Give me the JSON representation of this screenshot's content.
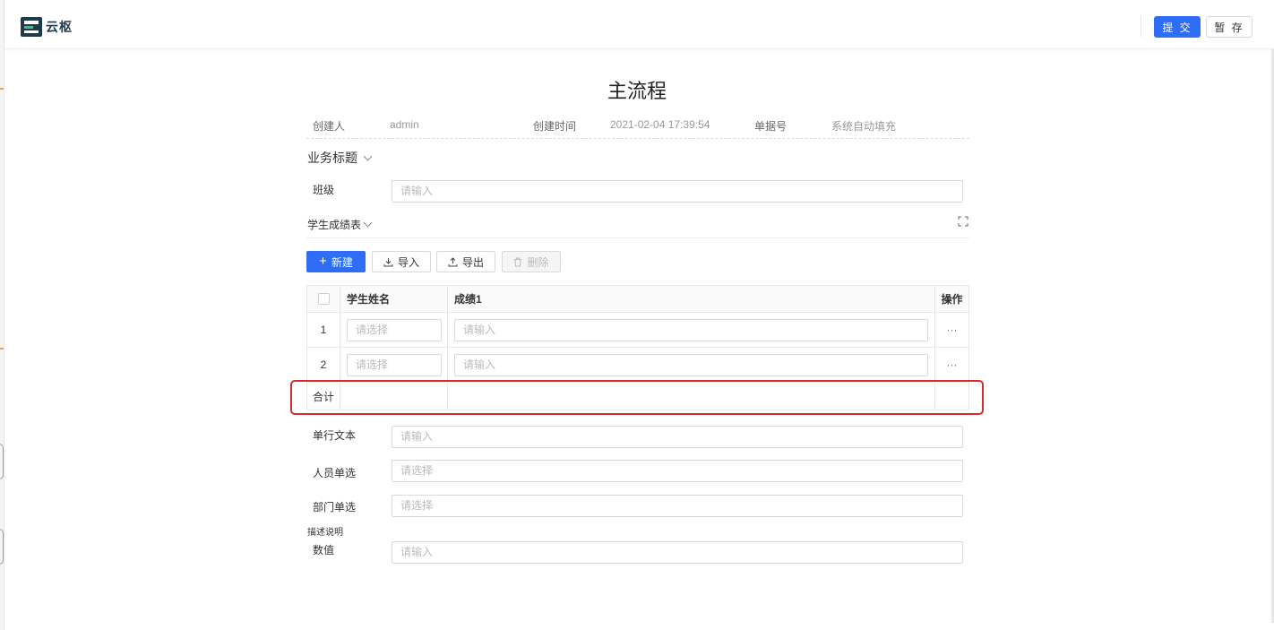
{
  "app": {
    "logo_text": "云枢",
    "brand_color": "#2f6df6"
  },
  "toolbar": {
    "submit_label": "提 交",
    "save_label": "暂 存"
  },
  "form": {
    "title": "主流程",
    "meta": {
      "creator_label": "创建人",
      "creator_value": "admin",
      "created_time_label": "创建时间",
      "created_time_value": "2021-02-04 17:39:54",
      "doc_no_label": "单据号",
      "doc_no_value": "系统自动填充"
    },
    "section_business_title": "业务标题",
    "class_field": {
      "label": "班级",
      "placeholder": "请输入"
    },
    "subtable": {
      "title": "学生成绩表",
      "buttons": {
        "new": "新建",
        "import": "导入",
        "export": "导出",
        "delete": "删除"
      },
      "columns": {
        "student_name": "学生姓名",
        "score": "成绩1",
        "actions": "操作"
      },
      "rows": [
        {
          "index": "1",
          "name_placeholder": "请选择",
          "score_placeholder": "请输入",
          "more": "···"
        },
        {
          "index": "2",
          "name_placeholder": "请选择",
          "score_placeholder": "请输入",
          "more": "···"
        }
      ],
      "total_label": "合计"
    },
    "fields": [
      {
        "label": "单行文本",
        "placeholder": "请输入"
      },
      {
        "label": "人员单选",
        "placeholder": "请选择"
      },
      {
        "label": "部门单选",
        "placeholder": "请选择"
      },
      {
        "label": "数值",
        "placeholder": "请输入"
      }
    ],
    "description_note": "描述说明"
  }
}
